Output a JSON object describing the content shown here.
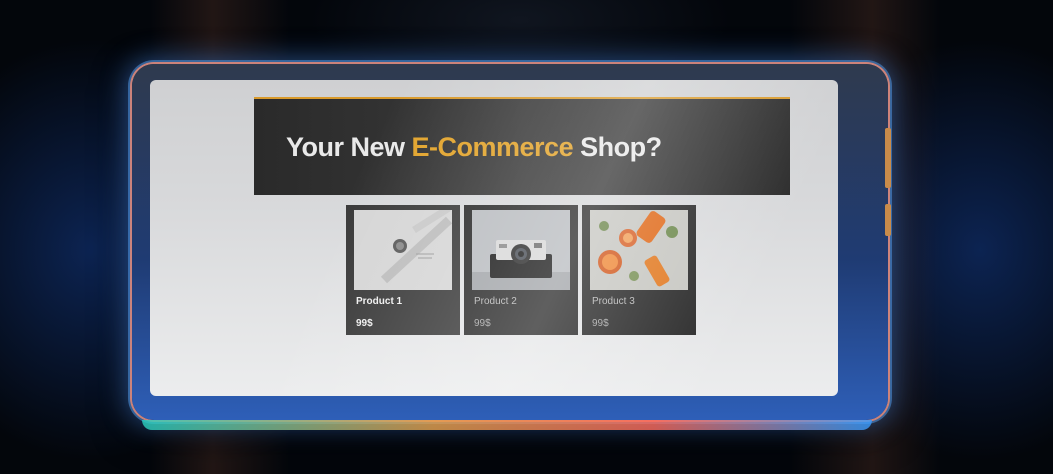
{
  "hero": {
    "title_part1": "Your New ",
    "title_accent": "E-Commerce",
    "title_part2": " Shop?"
  },
  "products": [
    {
      "name": "Product 1",
      "price": "99$",
      "image": "watch-photo"
    },
    {
      "name": "Product 2",
      "price": "99$",
      "image": "camera-photo"
    },
    {
      "name": "Product 3",
      "price": "99$",
      "image": "citrus-cosmetics-photo"
    }
  ],
  "colors": {
    "accent": "#e2a32a",
    "hero_bg": "#333333",
    "card_bg": "#2a2a2a",
    "screen_bg": "#dcdcdc"
  }
}
